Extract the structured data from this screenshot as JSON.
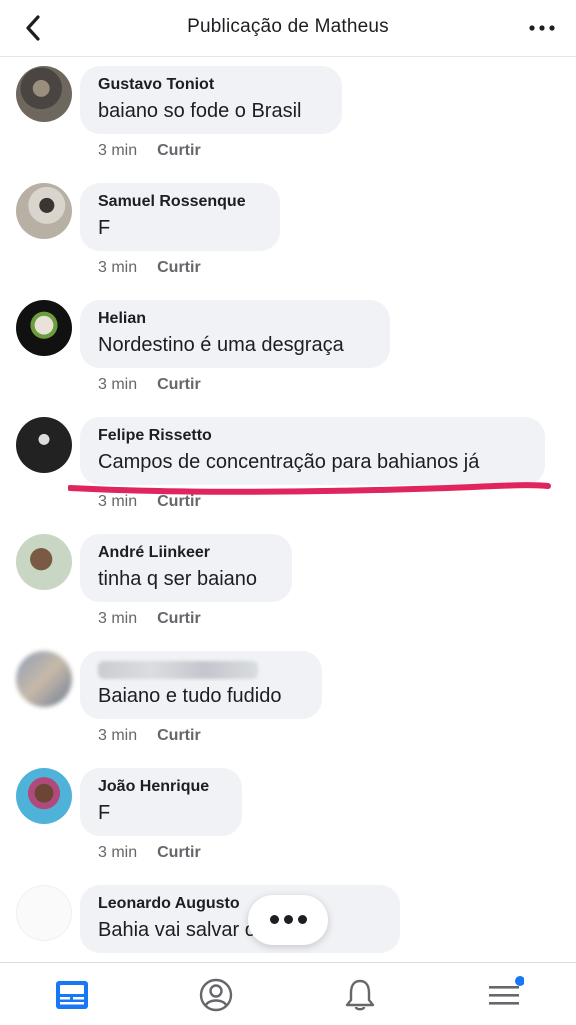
{
  "header": {
    "title": "Publicação de Matheus"
  },
  "comments": [
    {
      "author": "Gustavo Toniot",
      "text": "baiano so fode o Brasil",
      "time": "3 min",
      "like_label": "Curtir"
    },
    {
      "author": "Samuel Rossenque",
      "text": "F",
      "time": "3 min",
      "like_label": "Curtir"
    },
    {
      "author": "Helian",
      "text": "Nordestino é uma desgraça",
      "time": "3 min",
      "like_label": "Curtir"
    },
    {
      "author": "Felipe Rissetto",
      "text": "Campos de concentração para bahianos já",
      "time": "3 min",
      "like_label": "Curtir"
    },
    {
      "author": "André Liinkeer",
      "text": "tinha q ser baiano",
      "time": "3 min",
      "like_label": "Curtir"
    },
    {
      "author": "",
      "text": "Baiano e tudo fudido",
      "time": "3 min",
      "like_label": "Curtir"
    },
    {
      "author": "João Henrique",
      "text": "F",
      "time": "3 min",
      "like_label": "Curtir"
    },
    {
      "author": "Leonardo Augusto",
      "text": "Bahia vai salvar o país",
      "time": "",
      "like_label": ""
    }
  ],
  "tabs": [
    {
      "icon": "news-feed-icon",
      "active": true
    },
    {
      "icon": "profile-icon",
      "active": false
    },
    {
      "icon": "notifications-bell-icon",
      "active": false
    },
    {
      "icon": "menu-icon",
      "active": false,
      "badge": true
    }
  ],
  "colors": {
    "accent": "#1877f2",
    "bubble": "#f0f2f5",
    "meta": "#65676b",
    "underline": "#e0245e"
  }
}
